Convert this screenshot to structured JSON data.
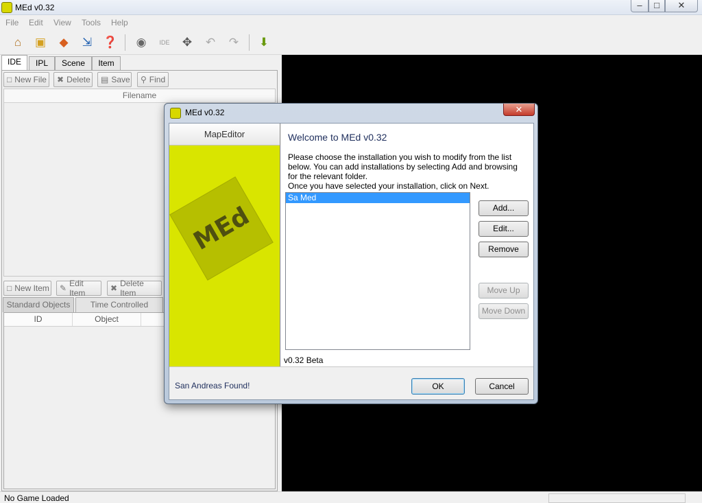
{
  "window": {
    "title": "MEd v0.32"
  },
  "menu": [
    "File",
    "Edit",
    "View",
    "Tools",
    "Help"
  ],
  "toolbar": {
    "icons": [
      "home-icon",
      "open-folder-icon",
      "tag-icon",
      "resize-icon",
      "help-pointer-icon",
      "record-icon",
      "ide-icon",
      "move-icon",
      "undo-icon",
      "redo-icon",
      "download-arrow-icon"
    ],
    "ide_label": "IDE"
  },
  "tabs": [
    "IDE",
    "IPL",
    "Scene",
    "Item"
  ],
  "file_buttons": {
    "new_file": "New File",
    "delete": "Delete",
    "save": "Save",
    "find": "Find"
  },
  "file_list": {
    "header": "Filename"
  },
  "item_buttons": {
    "new_item": "New Item",
    "edit_item": "Edit Item",
    "delete_item": "Delete Item"
  },
  "object_tabs": [
    "Standard Objects",
    "Time Controlled Objects"
  ],
  "object_columns": [
    "ID",
    "Object"
  ],
  "status": {
    "text": "No Game Loaded"
  },
  "dialog": {
    "title": "MEd v0.32",
    "sidebar_title": "MapEditor",
    "logo_text": "MEd",
    "welcome": "Welcome to MEd v0.32",
    "description_1": "Please choose the installation you wish to modify from the list below. You can add installations by selecting Add and browsing for the relevant folder.",
    "description_2": "Once you have selected your installation, click on Next.",
    "installations": [
      "Sa Med"
    ],
    "buttons": {
      "add": "Add...",
      "edit": "Edit...",
      "remove": "Remove",
      "move_up": "Move Up",
      "move_down": "Move Down"
    },
    "version": "v0.32 Beta",
    "found_text": "San Andreas Found!",
    "ok": "OK",
    "cancel": "Cancel"
  },
  "colors": {
    "logo_yellow": "#d9e500",
    "selection": "#3399ff",
    "viewport": "#000000"
  }
}
